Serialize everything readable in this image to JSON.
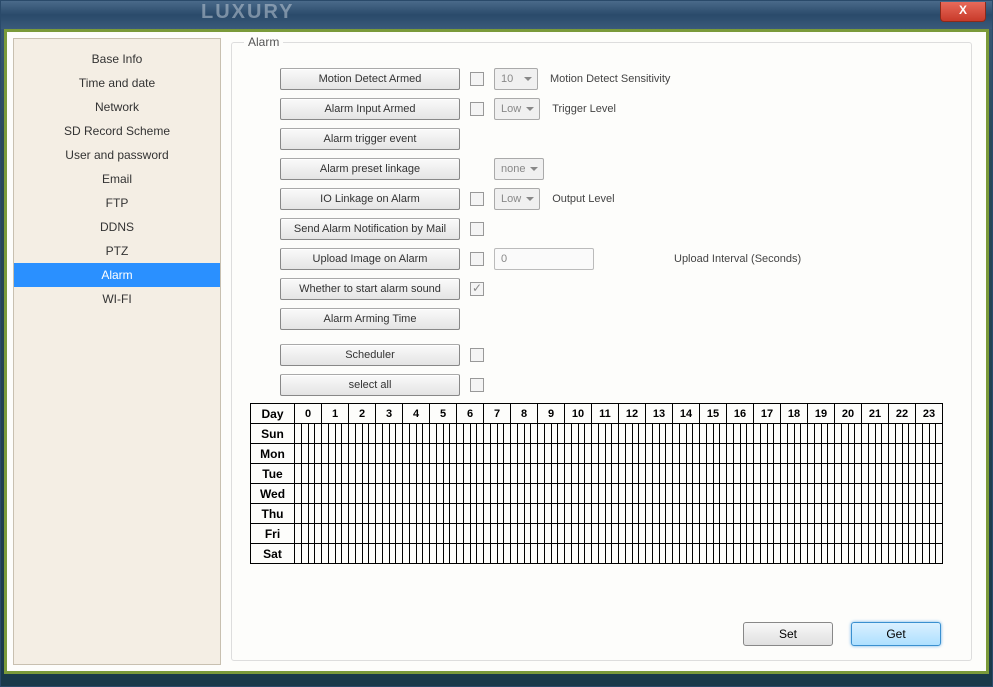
{
  "titlebar": {
    "bg_text": "LUXURY",
    "close": "X"
  },
  "sidebar": {
    "items": [
      {
        "label": "Base Info"
      },
      {
        "label": "Time and date"
      },
      {
        "label": "Network"
      },
      {
        "label": "SD Record Scheme"
      },
      {
        "label": "User and password"
      },
      {
        "label": "Email"
      },
      {
        "label": "FTP"
      },
      {
        "label": "DDNS"
      },
      {
        "label": "PTZ"
      },
      {
        "label": "Alarm"
      },
      {
        "label": "WI-FI"
      }
    ],
    "active_index": 9
  },
  "panel": {
    "legend": "Alarm",
    "rows": {
      "motion_detect": {
        "btn": "Motion Detect Armed",
        "dd": "10",
        "lbl": "Motion Detect Sensitivity"
      },
      "alarm_input": {
        "btn": "Alarm Input Armed",
        "dd": "Low",
        "lbl": "Trigger Level"
      },
      "trigger_event": {
        "btn": "Alarm trigger event"
      },
      "preset_link": {
        "btn": "Alarm preset linkage",
        "dd": "none"
      },
      "io_linkage": {
        "btn": "IO Linkage on Alarm",
        "dd": "Low",
        "lbl": "Output Level"
      },
      "send_mail": {
        "btn": "Send Alarm Notification by Mail"
      },
      "upload_img": {
        "btn": "Upload Image on Alarm",
        "txt": "0",
        "lbl": "Upload Interval (Seconds)"
      },
      "alarm_sound": {
        "btn": "Whether to start alarm sound"
      },
      "arming_time": {
        "btn": "Alarm Arming Time"
      },
      "scheduler": {
        "btn": "Scheduler"
      },
      "select_all": {
        "btn": "select all"
      }
    },
    "schedule": {
      "day_header": "Day",
      "hours": [
        "0",
        "1",
        "2",
        "3",
        "4",
        "5",
        "6",
        "7",
        "8",
        "9",
        "10",
        "11",
        "12",
        "13",
        "14",
        "15",
        "16",
        "17",
        "18",
        "19",
        "20",
        "21",
        "22",
        "23"
      ],
      "days": [
        "Sun",
        "Mon",
        "Tue",
        "Wed",
        "Thu",
        "Fri",
        "Sat"
      ]
    },
    "buttons": {
      "set": "Set",
      "get": "Get"
    }
  }
}
